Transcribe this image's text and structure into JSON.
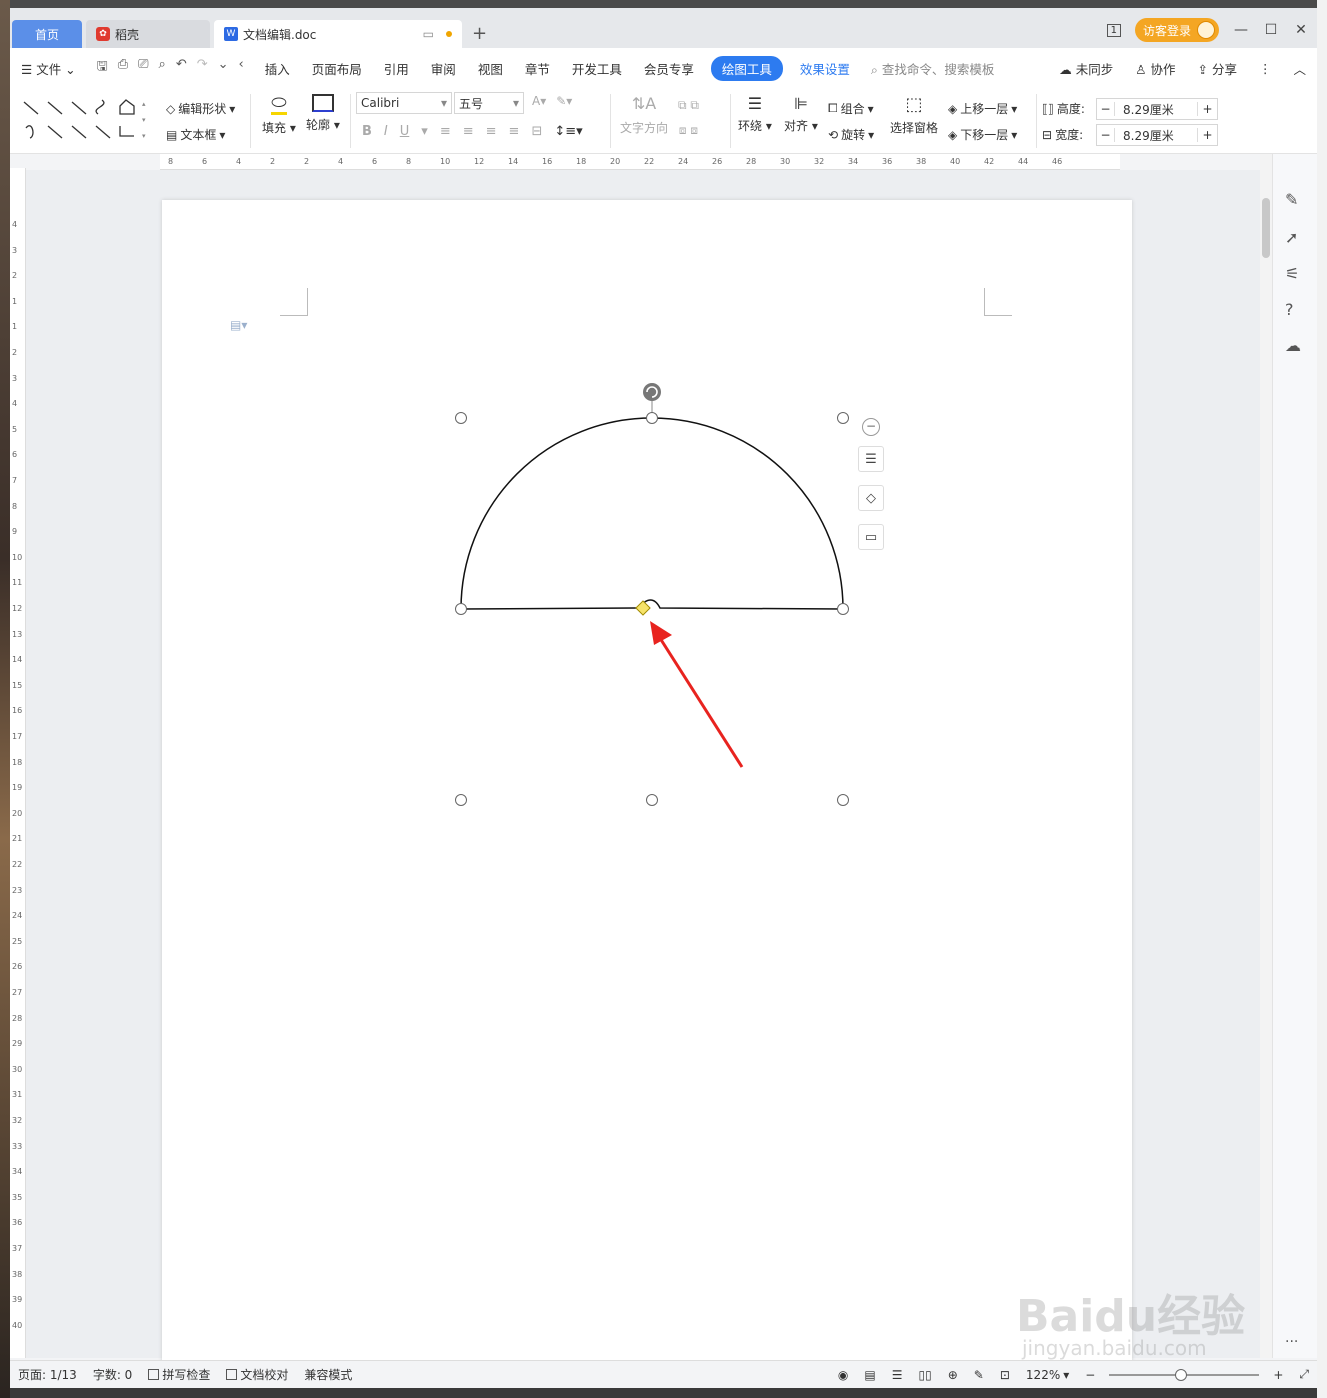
{
  "tabs": {
    "home": "首页",
    "daoke": "稻壳",
    "doc": "文档编辑.doc"
  },
  "titlebar": {
    "login": "访客登录",
    "page_indicator": "1"
  },
  "menu": {
    "file": "文件",
    "items": [
      "插入",
      "页面布局",
      "引用",
      "审阅",
      "视图",
      "章节",
      "开发工具",
      "会员专享"
    ],
    "active": "绘图工具",
    "effect": "效果设置",
    "search": "查找命令、搜索模板",
    "sync": "未同步",
    "collab": "协作",
    "share": "分享"
  },
  "ribbon": {
    "edit_shape": "编辑形状",
    "textbox": "文本框",
    "fill": "填充",
    "outline": "轮廓",
    "font_name": "Calibri",
    "font_size": "五号",
    "text_dir": "文字方向",
    "wrap": "环绕",
    "align": "对齐",
    "group": "组合",
    "rotate": "旋转",
    "selection_pane": "选择窗格",
    "bring_forward": "上移一层",
    "send_backward": "下移一层",
    "height_label": "高度:",
    "height_value": "8.29厘米",
    "width_label": "宽度:",
    "width_value": "8.29厘米"
  },
  "ruler_top": [
    "8",
    "6",
    "4",
    "2",
    "2",
    "4",
    "6",
    "8",
    "10",
    "12",
    "14",
    "16",
    "18",
    "20",
    "22",
    "24",
    "26",
    "28",
    "30",
    "32",
    "34",
    "36",
    "38",
    "40",
    "42",
    "44",
    "46"
  ],
  "ruler_left": [
    "4",
    "3",
    "2",
    "1",
    "1",
    "2",
    "3",
    "4",
    "5",
    "6",
    "7",
    "8",
    "9",
    "10",
    "11",
    "12",
    "13",
    "14",
    "15",
    "16",
    "17",
    "18",
    "19",
    "20",
    "21",
    "22",
    "23",
    "24",
    "25",
    "26",
    "27",
    "28",
    "29",
    "30",
    "31",
    "32",
    "33",
    "34",
    "35",
    "36",
    "37",
    "38",
    "39",
    "40"
  ],
  "status": {
    "page": "页面: 1/13",
    "words": "字数: 0",
    "spell": "拼写检查",
    "proof": "文档校对",
    "compat": "兼容模式",
    "zoom": "122%"
  },
  "watermark": {
    "brand": "Baidu经验",
    "url": "jingyan.baidu.com"
  },
  "colors": {
    "accent": "#2d7bf0",
    "home_tab": "#5b8fe8",
    "login": "#f4a623",
    "arrow": "#e8231f",
    "handle_yellow": "#f6e36a"
  }
}
